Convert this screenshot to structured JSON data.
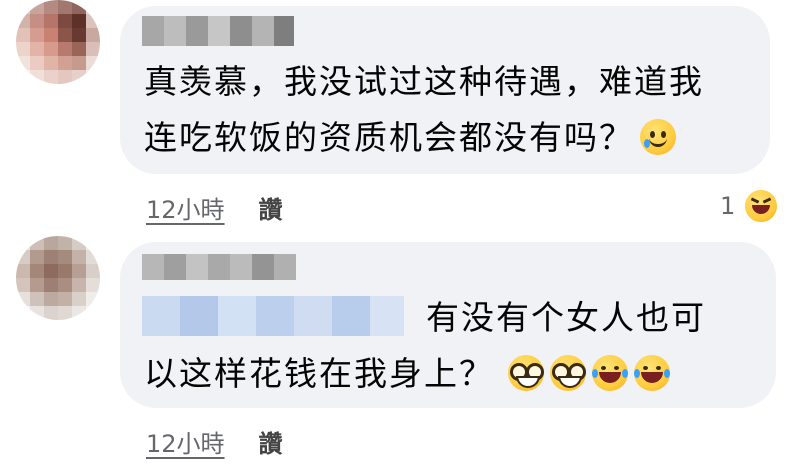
{
  "comments": [
    {
      "body_lines": [
        "真羡慕，我没试过这种待遇，难道我",
        "连吃软饭的资质机会都没有吗？"
      ],
      "emojis": [
        "smiling-with-tear-emoji"
      ],
      "time": "12小時",
      "like_label": "讚",
      "reaction_count": "1",
      "reaction_icon": "laughing-squint-icon"
    },
    {
      "body_lines": [
        "有没有个女人也可",
        "以这样花钱在我身上？"
      ],
      "emojis": [
        "nerd-face-emoji",
        "nerd-face-emoji",
        "tears-of-joy-emoji",
        "tears-of-joy-emoji"
      ],
      "time": "12小時",
      "like_label": "讚"
    }
  ],
  "colors": {
    "bubble": "#f0f2f5",
    "meta_text": "#65676b",
    "body_text": "#050505"
  }
}
